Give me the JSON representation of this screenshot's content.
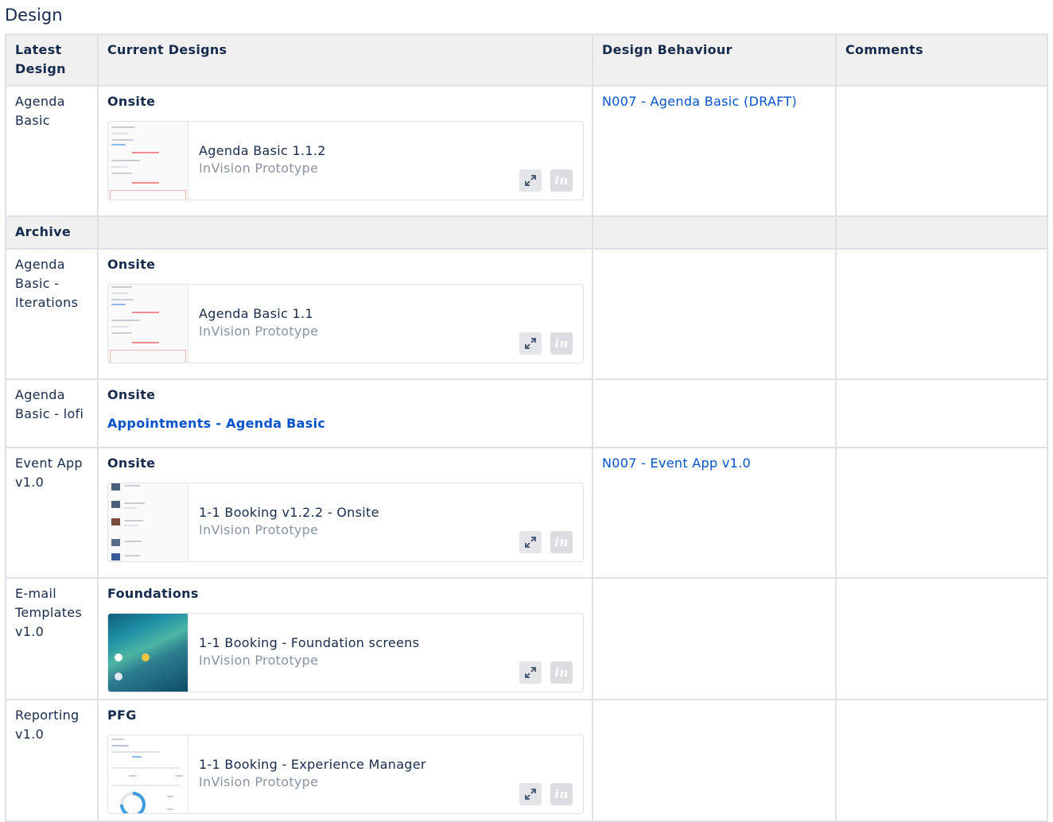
{
  "page": {
    "title": "Design"
  },
  "table": {
    "headers": [
      "Latest Design",
      "Current Designs",
      "Design Behaviour",
      "Comments"
    ],
    "archive_label": "Archive",
    "rows": [
      {
        "name": "Agenda Basic",
        "group": "Onsite",
        "embed": {
          "title": "Agenda Basic 1.1.2",
          "subtitle": "InVision Prototype",
          "thumb": "agenda"
        },
        "behaviour": "N007 - Agenda Basic (DRAFT)",
        "comments": ""
      },
      {
        "name": "Agenda Basic - Iterations",
        "group": "Onsite",
        "embed": {
          "title": "Agenda Basic 1.1",
          "subtitle": "InVision Prototype",
          "thumb": "agenda"
        },
        "behaviour": "",
        "comments": ""
      },
      {
        "name": "Agenda Basic - lofi",
        "group": "Onsite",
        "link": "Appointments - Agenda Basic",
        "behaviour": "",
        "comments": ""
      },
      {
        "name": "Event App v1.0",
        "group": "Onsite",
        "embed": {
          "title": "1-1 Booking v1.2.2 - Onsite",
          "subtitle": "InVision Prototype",
          "thumb": "people"
        },
        "behaviour": "N007 - Event App v1.0",
        "comments": ""
      },
      {
        "name": "E-mail Templates v1.0",
        "group": "Foundations",
        "embed": {
          "title": "1-1 Booking - Foundation screens",
          "subtitle": "InVision Prototype",
          "thumb": "ocean"
        },
        "behaviour": "",
        "comments": ""
      },
      {
        "name": "Reporting v1.0",
        "group": "PFG",
        "embed": {
          "title": "1-1 Booking - Experience Manager",
          "subtitle": "InVision Prototype",
          "thumb": "analytics"
        },
        "behaviour": "",
        "comments": ""
      }
    ]
  },
  "icons": {
    "expand": "expand-icon",
    "invision": "invision-logo-icon",
    "invision_glyph": "in"
  },
  "colors": {
    "link": "#0052cc",
    "header_bg": "#f0f0f0",
    "border": "#dfe1e6",
    "text": "#172b4d",
    "muted": "#8993a4"
  }
}
